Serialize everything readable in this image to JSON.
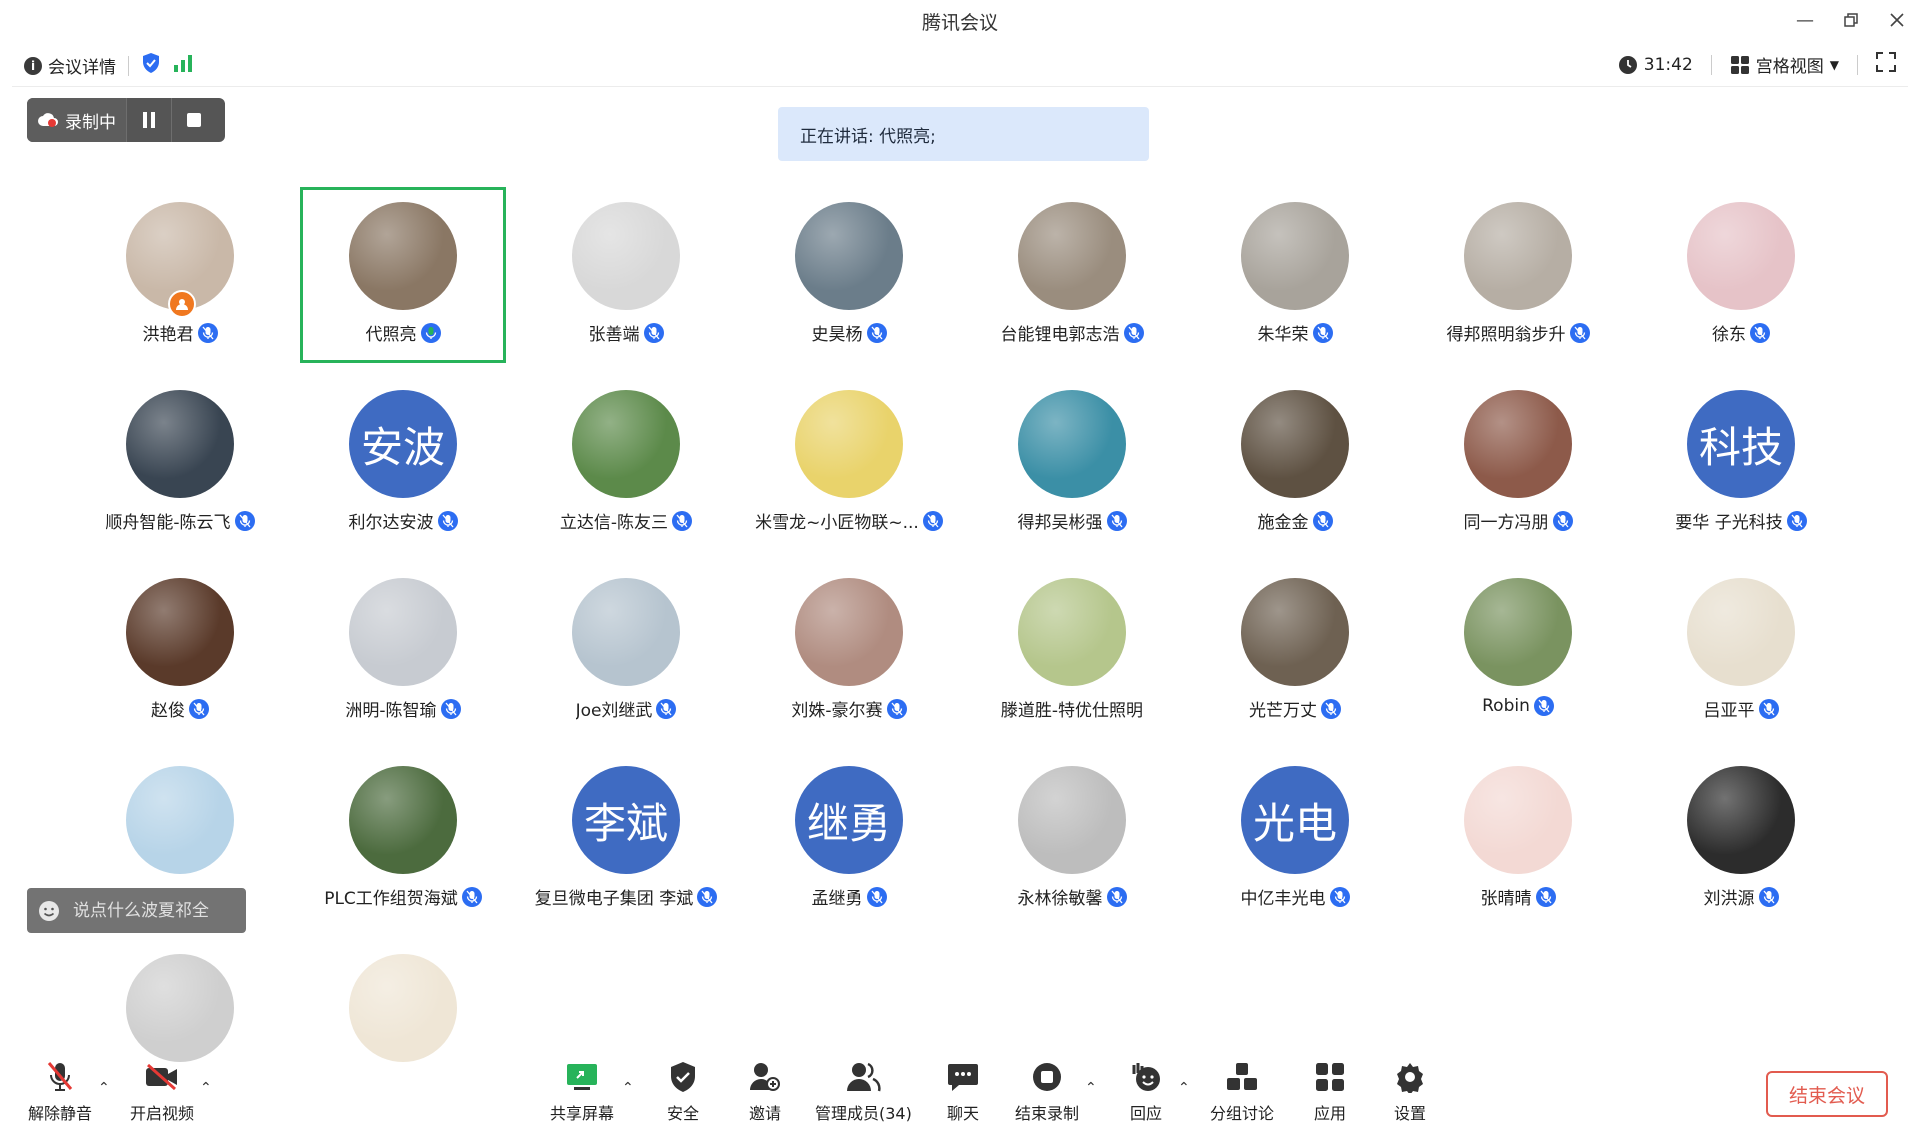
{
  "window": {
    "title": "腾讯会议"
  },
  "infobar": {
    "meeting_details": "会议详情",
    "timer": "31:42",
    "view_mode": "宫格视图"
  },
  "recording": {
    "status": "录制中"
  },
  "speaking": {
    "text": "正在讲话: 代照亮;"
  },
  "participants": [
    {
      "name": "洪艳君"
    },
    {
      "name": "代照亮"
    },
    {
      "name": "张善端"
    },
    {
      "name": "史昊杨"
    },
    {
      "name": "台能锂电郭志浩"
    },
    {
      "name": "朱华荣"
    },
    {
      "name": "得邦照明翁步升"
    },
    {
      "name": "徐东"
    },
    {
      "name": "顺舟智能-陈云飞"
    },
    {
      "name": "利尔达安波",
      "avatar_text": "安波"
    },
    {
      "name": "立达信-陈友三"
    },
    {
      "name": "米雪龙~小匠物联~..."
    },
    {
      "name": "得邦吴彬强"
    },
    {
      "name": "施金金"
    },
    {
      "name": "同一方冯朋"
    },
    {
      "name": "要华 子光科技",
      "avatar_text": "科技"
    },
    {
      "name": "赵俊"
    },
    {
      "name": "洲明-陈智瑜"
    },
    {
      "name": "Joe刘继武"
    },
    {
      "name": "刘姝-豪尔赛"
    },
    {
      "name": "滕道胜-特优仕照明"
    },
    {
      "name": "光芒万丈"
    },
    {
      "name": "Robin"
    },
    {
      "name": "吕亚平"
    },
    {
      "name": ""
    },
    {
      "name": "PLC工作组贺海斌"
    },
    {
      "name": "复旦微电子集团 李斌",
      "avatar_text": "李斌"
    },
    {
      "name": "孟继勇",
      "avatar_text": "继勇"
    },
    {
      "name": "永林徐敏馨"
    },
    {
      "name": "中亿丰光电",
      "avatar_text": "光电"
    },
    {
      "name": "张晴晴"
    },
    {
      "name": "刘洪源"
    },
    {
      "name": ""
    },
    {
      "name": ""
    }
  ],
  "chat": {
    "placeholder": "说点什么波夏祁全"
  },
  "toolbar": {
    "unmute": "解除静音",
    "start_video": "开启视频",
    "share_screen": "共享屏幕",
    "security": "安全",
    "invite": "邀请",
    "manage_members": "管理成员(34)",
    "chat": "聊天",
    "end_recording": "结束录制",
    "reactions": "回应",
    "breakout": "分组讨论",
    "apps": "应用",
    "settings": "设置",
    "end_meeting": "结束会议"
  },
  "colors": {
    "accent": "#2c6df2",
    "avatar_bg": "#3f6bc2",
    "speaking_bg": "#dbe8fb",
    "focus": "#27b35a",
    "end": "#e25b4f"
  }
}
